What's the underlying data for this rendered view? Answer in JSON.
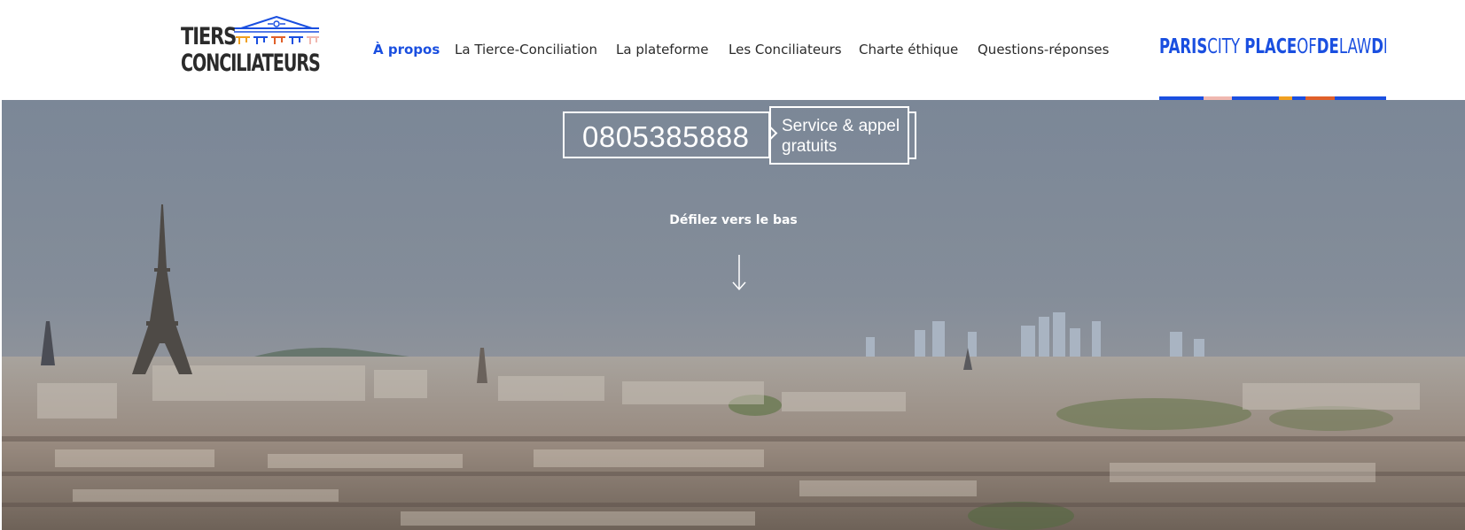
{
  "header": {
    "logo": {
      "line1": "TIERS",
      "line2": "CONCILIATEURS"
    },
    "nav": [
      {
        "label": "À propos",
        "active": true
      },
      {
        "label": "La Tierce-Conciliation",
        "active": false
      },
      {
        "label": "La plateforme",
        "active": false
      },
      {
        "label": "Les Conciliateurs",
        "active": false
      },
      {
        "label": "Charte éthique",
        "active": false
      },
      {
        "label": "Questions-réponses",
        "active": false
      }
    ],
    "partner": {
      "paris": "PARIS",
      "city": "CITY",
      "place": "PLACE",
      "of": "OF",
      "de": "DE",
      "law": "LAW",
      "droit": "DROIT"
    }
  },
  "hero": {
    "phone": "0805385888",
    "service": "Service & appel gratuits",
    "scroll_label": "Défilez vers le bas"
  },
  "colors": {
    "accent": "#1a4fe0",
    "text": "#2b2b2b",
    "stripe": [
      "#1a4fe0",
      "#f0b8b0",
      "#1a4fe0",
      "#f0a020",
      "#1a4fe0",
      "#e0602a",
      "#1a4fe0"
    ]
  },
  "icons": {
    "logo_emblem": "building-pediment-icon",
    "scroll": "arrow-down-icon"
  }
}
